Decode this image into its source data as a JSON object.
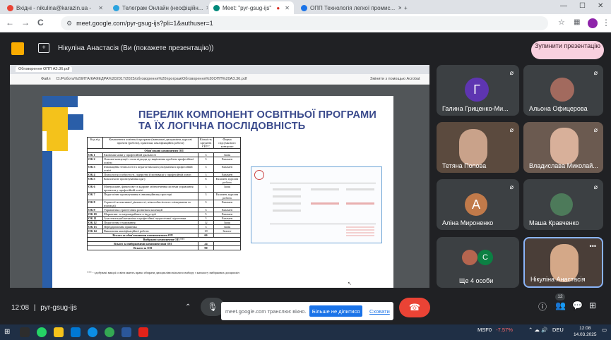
{
  "browser": {
    "tabs": [
      {
        "label": "Вхідні - nikulina@karazin.ua -"
      },
      {
        "label": "Телеграм Онлайн (неофіційн..."
      },
      {
        "label": "Meet: \"pyr-gsug-ijs\""
      },
      {
        "label": "ОПП Технологія легкої промис..."
      }
    ],
    "url": "meet.google.com/pyr-gsug-ijs?pli=1&authuser=1",
    "back": "←",
    "forward": "→",
    "reload": "C"
  },
  "meet": {
    "presenter_label": "Нікуліна Анастасія (Ви (покажете презентацію))",
    "stop_button": "Зупинити презентацію"
  },
  "pdf": {
    "tab_label": "Обговорення ОПП АЗ.36.pdf",
    "file_label": "Файл",
    "path": "D:/Робота%20ИТА/КАФЕДРА%202017/2025/обговорення%20програм/Обговорення%20ОПП%20АЗ.36.pdf",
    "toolbar_hint": "Змінити з помощью Acrobat"
  },
  "slide": {
    "title_line1": "ПЕРЕЛІК КОМПОНЕНТ ОСВІТНЬОЇ ПРОГРАМИ",
    "title_line2": "ТА ЇХ ЛОГІЧНА ПОСЛІДОВНІСТЬ",
    "table": {
      "headers": [
        "Код н/д",
        "Компоненти освітньої програми (навчальні дисципліни, курсові проекти (роботи), практики, кваліфікаційна робота)",
        "Кількість кредитів ЄКТС",
        "Форма підсумкового контролю"
      ],
      "section1": "Обов'язкові компоненти ОП",
      "rows": [
        [
          "ОК 1",
          "Економія мови у професійній діяльності",
          "3",
          "Залік"
        ],
        [
          "ОК 2",
          "Основні концепції з ноля підходи до вирішення проблем професійної освіти",
          "3",
          "Екзамен"
        ],
        [
          "ОК 3",
          "Інноваційна технології та педагогічна консультування в професійній освіті",
          "3",
          "Екзамен"
        ],
        [
          "ОК 4",
          "Психологія особистості, лідерство й мотивації у професійній освіті",
          "3",
          "Екзамен"
        ],
        [
          "ОК 5",
          "Комплексне проектування одягу",
          "6",
          "Екзамен, курсова робота"
        ],
        [
          "ОК 6",
          "Матеріальне, фінансове та кадрове забезпечення системи управління проектом у професійній освіті",
          "3",
          "Залік"
        ],
        [
          "ОК 7",
          "Педагогічне проектування в інноваційному просторі",
          "3",
          "Екзамен, курсова робота"
        ],
        [
          "ОК 8",
          "Стратегії колективної діяльності, міжособистісного спілкування та взаємодії",
          "3",
          "Екзамен"
        ],
        [
          "ОК 9",
          "Управління стратегічним розвитком колекцій",
          "3",
          "Екзамен"
        ],
        [
          "ОК 10",
          "Маркетинг та мерчандайзинг в індустрії",
          "5",
          "Екзамен"
        ],
        [
          "ОК 11",
          "Асистентський механізм з професійної педагогічної підготовки",
          "3",
          "Екзамен"
        ],
        [
          "ОК 12",
          "Педагогічна стажування",
          "12",
          "Залік"
        ],
        [
          "ОК 13",
          "Переддипломна практика",
          "3",
          "Залік"
        ],
        [
          "ОК 14",
          "Виконання кваліфікаційної роботи",
          "18",
          "Захист"
        ]
      ],
      "total_mandatory": [
        "Всього за обов'язковими компонентами ОП",
        "66"
      ],
      "section2": "Вибіркові компоненти ОП ***",
      "total_elective": [
        "Всього за вибірковими компонентами ОП",
        "24"
      ],
      "total": [
        "Всього за ОП",
        "90"
      ]
    },
    "footnote": "*** - здобувачі вищої освіти мають право обирати дисципліни вільного вибору з каталогу вибіркових дисциплін"
  },
  "participants": [
    {
      "name": "Галина Гриценко-Ми...",
      "initial": "Г",
      "color": "#5e35b1"
    },
    {
      "name": "Альона Офицерова"
    },
    {
      "name": "Тетяна Попова"
    },
    {
      "name": "Владиславa Миколай..."
    },
    {
      "name": "Аліна Мироненко",
      "initial": "А",
      "color": "#c17a4a"
    },
    {
      "name": "Маша Кравченко"
    },
    {
      "name": "Ще 4 особи",
      "initial": "С",
      "color": "#0b8043"
    },
    {
      "name": "Нікуліна Анастасія"
    }
  ],
  "bottombar": {
    "time": "12:08",
    "separator": "|",
    "code": "pyr-gsug-ijs",
    "badge": "12",
    "notification": "meet.google.com транслює вікно.",
    "share_btn": "Більше не ділитися",
    "hide_btn": "Сховати"
  },
  "taskbar": {
    "stock": "MSF0",
    "change": "-7.57%",
    "lang": "DEU",
    "time": "12:08",
    "date": "14.03.2025"
  },
  "colors": {
    "meet_bg": "#202124",
    "end_call": "#ea4335",
    "stop_button": "#f9d0df",
    "slide_title": "#3a4a8c",
    "deco_blue": "#2a5ea8",
    "deco_yellow": "#f4c21b"
  }
}
